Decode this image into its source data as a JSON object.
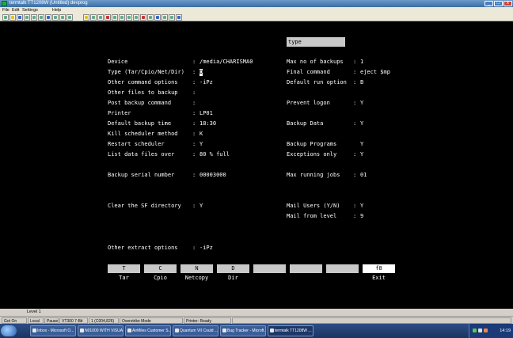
{
  "window": {
    "title": "termtalk TT1208W (Untitled) devprog",
    "minimize_glyph": "_",
    "maximize_glyph": "□",
    "close_glyph": "x"
  },
  "menu": [
    "File",
    "Edit",
    "Settings",
    "Help"
  ],
  "terminal": {
    "type_box": "type",
    "left_fields": [
      {
        "label": "Device",
        "value": "/media/CHARISMA0"
      },
      {
        "label": "Type (Tar/Cpio/Net/Dir)",
        "value": "D"
      },
      {
        "label": "Other command options",
        "value": "-iPz"
      },
      {
        "label": "Other files to backup",
        "value": ""
      },
      {
        "label": "Post backup command",
        "value": ""
      },
      {
        "label": "Printer",
        "value": "LP01"
      },
      {
        "label": "Default backup time",
        "value": "18:30"
      },
      {
        "label": "Kill scheduler method",
        "value": "K"
      },
      {
        "label": "Restart scheduler",
        "value": "Y"
      },
      {
        "label": "List data files over",
        "value": "80 % full"
      },
      {
        "label": "Backup serial number",
        "value": "00003000"
      },
      {
        "label": "Clear the SF directory",
        "value": "Y"
      },
      {
        "label": "Other extract options",
        "value": "-iPz"
      }
    ],
    "right_fields": [
      {
        "label": "Max no of backups",
        "value": "1"
      },
      {
        "label": "Final command",
        "value": "eject $mp"
      },
      {
        "label": "Default run option",
        "value": "B"
      },
      {
        "label": "Prevent logon",
        "value": "Y"
      },
      {
        "label": "Backup Data",
        "value": "Y"
      },
      {
        "label": "Backup Programs",
        "value": "Y"
      },
      {
        "label": "Exceptions only",
        "value": "Y"
      },
      {
        "label": "Max running jobs",
        "value": "01"
      },
      {
        "label": "Mail Users (Y/N)",
        "value": "Y"
      },
      {
        "label": "Mail from level",
        "value": "9"
      }
    ],
    "function_keys": [
      {
        "key": "T",
        "label": "Tar"
      },
      {
        "key": "C",
        "label": "Cpio"
      },
      {
        "key": "N",
        "label": "Netcopy"
      },
      {
        "key": "D",
        "label": "Dir"
      },
      {
        "key": "",
        "label": ""
      },
      {
        "key": "",
        "label": ""
      },
      {
        "key": "",
        "label": ""
      },
      {
        "key": "f8",
        "label": "Exit"
      }
    ]
  },
  "status_line": "Level 1",
  "status_bar": [
    "Got On",
    "Local",
    "Pause",
    "VT300 7-Bit",
    "1 (C004,826)",
    "Overstrike Mode",
    "Printer: Ready"
  ],
  "taskbar": {
    "items": [
      "Inbox - Microsoft O...",
      "N01000 WITH VISUAL...",
      "AirMiles Customer S...",
      "Quantum VII Could ...",
      "Bug Tracker - Microft...",
      "termtalk TT1208W ..."
    ],
    "clock": "14:19"
  }
}
